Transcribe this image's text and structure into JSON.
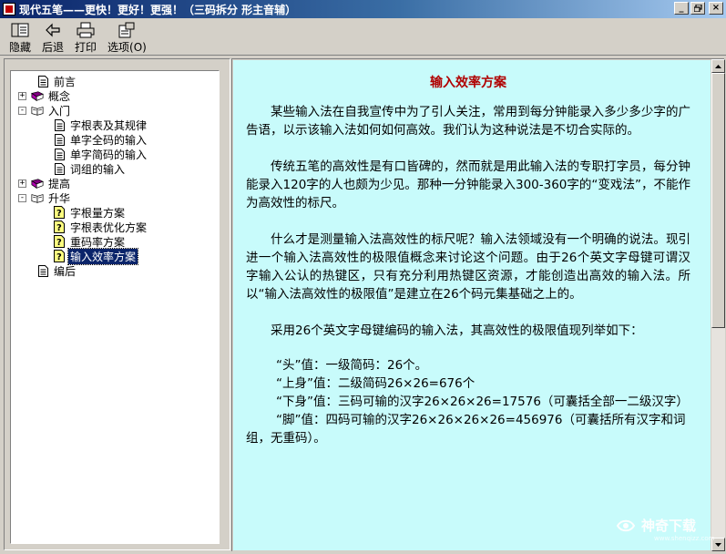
{
  "window": {
    "title": "现代五笔——更快！更好！更强！（三码拆分  形主音辅）",
    "controls": {
      "minimize": "_",
      "restore": "❐",
      "close": "×"
    }
  },
  "toolbar": {
    "hide_label": "隐藏",
    "back_label": "后退",
    "print_label": "打印",
    "options_label": "选项(O)"
  },
  "tree": {
    "items": [
      {
        "label": "前言",
        "icon": "page-icon",
        "expander": ""
      },
      {
        "label": "概念",
        "icon": "book-closed-icon",
        "expander": "+"
      },
      {
        "label": "入门",
        "icon": "book-open-icon",
        "expander": "-"
      },
      {
        "label": "字根表及其规律",
        "icon": "page-icon",
        "expander": ""
      },
      {
        "label": "单字全码的输入",
        "icon": "page-icon",
        "expander": ""
      },
      {
        "label": "单字简码的输入",
        "icon": "page-icon",
        "expander": ""
      },
      {
        "label": "词组的输入",
        "icon": "page-icon",
        "expander": ""
      },
      {
        "label": "提高",
        "icon": "book-closed-icon",
        "expander": "+"
      },
      {
        "label": "升华",
        "icon": "book-open-icon",
        "expander": "-"
      },
      {
        "label": "字根量方案",
        "icon": "question-page-icon",
        "expander": ""
      },
      {
        "label": "字根表优化方案",
        "icon": "question-page-icon",
        "expander": ""
      },
      {
        "label": "重码率方案",
        "icon": "question-page-icon",
        "expander": ""
      },
      {
        "label": "输入效率方案",
        "icon": "question-page-icon",
        "expander": "",
        "selected": true
      },
      {
        "label": "编后",
        "icon": "page-icon",
        "expander": ""
      }
    ]
  },
  "content": {
    "title": "输入效率方案",
    "paragraphs": [
      "某些输入法在自我宣传中为了引人关注，常用到每分钟能录入多少多少字的广告语，以示该输入法如何如何高效。我们认为这种说法是不切合实际的。",
      "传统五笔的高效性是有口皆碑的，然而就是用此输入法的专职打字员，每分钟能录入120字的人也颇为少见。那种一分钟能录入300-360字的“变戏法”，不能作为高效性的标尺。",
      "什么才是测量输入法高效性的标尺呢？输入法领域没有一个明确的说法。现引进一个输入法高效性的极限值概念来讨论这个问题。由于26个英文字母键可谓汉字输入公认的热键区，只有充分利用热键区资源，才能创造出高效的输入法。所以“输入法高效性的极限值”是建立在26个码元集基础之上的。",
      "采用26个英文字母键编码的输入法，其高效性的极限值现列举如下："
    ],
    "list": [
      "“头”值：一级简码：26个。",
      "“上身”值：二级简码26×26=676个",
      "“下身”值：三码可输的汉字26×26×26=17576（可囊括全部一二级汉字）",
      "“脚”值：四码可输的汉字26×26×26×26=456976（可囊括所有汉字和词组，无重码）。"
    ]
  },
  "watermark": {
    "text": "神奇下载",
    "sub": "www.shenqizz.com"
  },
  "colors": {
    "title_bar_start": "#0a246a",
    "title_bar_end": "#a6caf0",
    "content_bg": "#c8fbfb",
    "doc_title": "#b00000",
    "selection": "#0a246a"
  }
}
